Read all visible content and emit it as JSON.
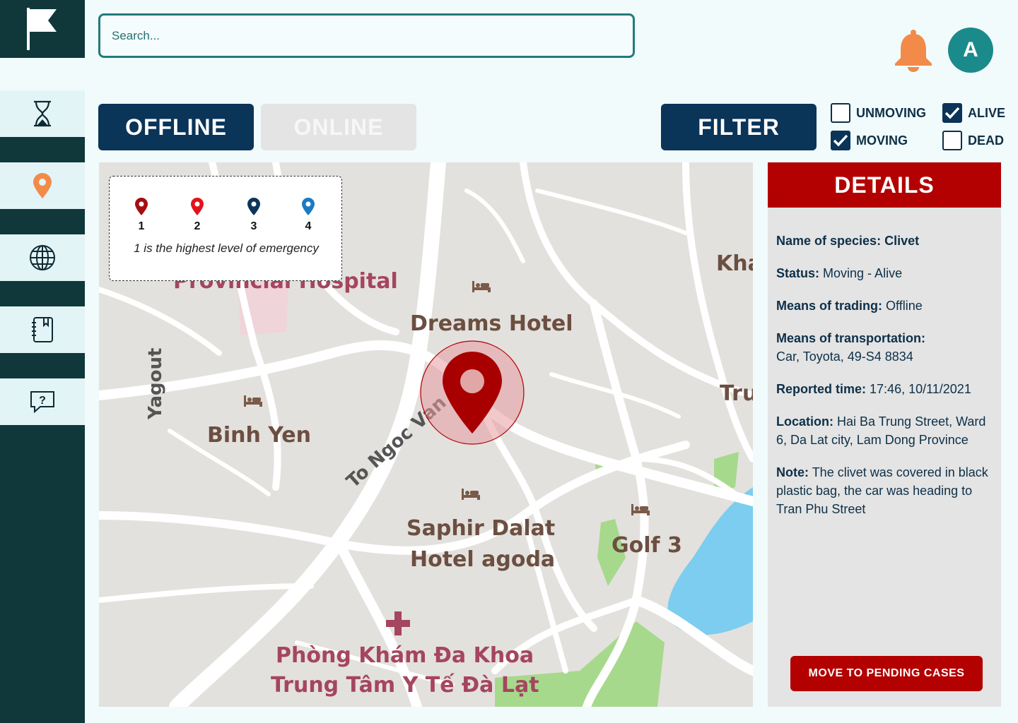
{
  "search": {
    "placeholder": "Search..."
  },
  "header": {
    "avatar_letter": "A",
    "notification_icon": "bell-icon"
  },
  "sidebar": {
    "logo_icon": "flag-icon",
    "items": [
      {
        "icon": "hourglass-icon",
        "name": "history"
      },
      {
        "icon": "location-pin-icon",
        "name": "map",
        "active": true
      },
      {
        "icon": "globe-icon",
        "name": "online"
      },
      {
        "icon": "notebook-icon",
        "name": "records"
      },
      {
        "icon": "question-icon",
        "name": "help"
      }
    ]
  },
  "tabs": {
    "offline": "OFFLINE",
    "online": "ONLINE",
    "active": "offline"
  },
  "filter": {
    "label": "FILTER",
    "options": [
      {
        "label": "UNMOVING",
        "checked": false
      },
      {
        "label": "MOVING",
        "checked": true
      },
      {
        "label": "ALIVE",
        "checked": true
      },
      {
        "label": "DEAD",
        "checked": false
      }
    ]
  },
  "legend": {
    "levels": [
      {
        "num": "1",
        "color": "#a60d10"
      },
      {
        "num": "2",
        "color": "#e3121a"
      },
      {
        "num": "3",
        "color": "#0d3559"
      },
      {
        "num": "4",
        "color": "#1a7bc4"
      }
    ],
    "note": "1 is the highest level of emergency"
  },
  "map_labels": {
    "hospital": "Provincial Hospital",
    "dreams": "Dreams Hotel",
    "binh_yen": "Binh Yen",
    "to_ngoc_van": "To Ngoc Van",
    "yagout": "Yagout",
    "saphir_1": "Saphir Dalat",
    "saphir_2": "Hotel agoda",
    "golf": "Golf 3",
    "clinic_1": "Phòng Khám Đa Khoa",
    "clinic_2": "Trung Tâm Y Tế Đà Lạt",
    "kha": "Kha",
    "tru": "Tru"
  },
  "details": {
    "title": "DETAILS",
    "species_label": "Name of species:",
    "species": "Clivet",
    "status_label": "Status:",
    "status": "Moving - Alive",
    "trading_label": "Means of trading:",
    "trading": "Offline",
    "transport_label": "Means of transportation:",
    "transport": "Car, Toyota, 49-S4 8834",
    "time_label": "Reported time:",
    "time": "17:46, 10/11/2021",
    "location_label": "Location:",
    "location": "Hai Ba Trung Street, Ward 6, Da Lat city, Lam Dong Province",
    "note_label": "Note:",
    "note": "The clivet was covered in black plastic bag, the car was heading to Tran Phu Street",
    "button": "MOVE TO PENDING CASES"
  },
  "colors": {
    "sidebar": "#10383b",
    "navy": "#0a3458",
    "red": "#b30000",
    "accent_orange": "#f28b4a"
  }
}
